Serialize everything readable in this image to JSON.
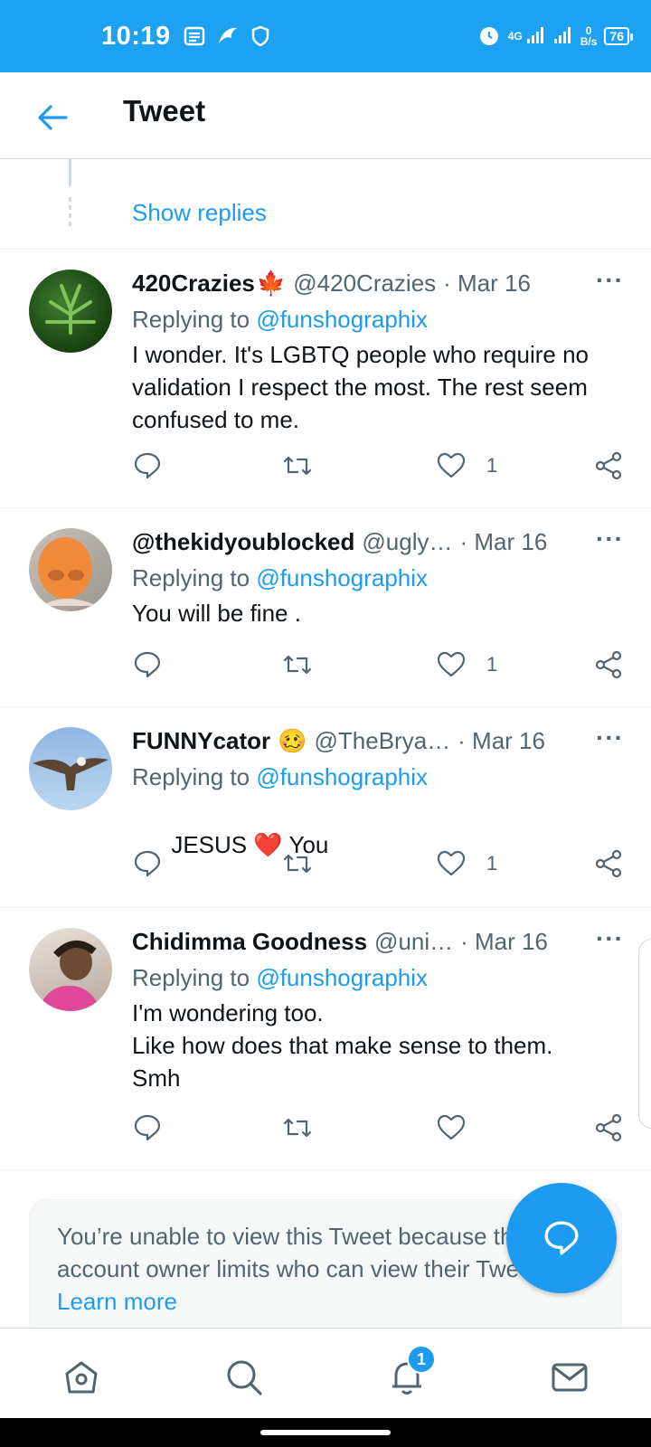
{
  "status_bar": {
    "time": "10:19",
    "network": "4G",
    "speed_top": "0",
    "speed_unit": "B/s",
    "battery": "76"
  },
  "header": {
    "title": "Tweet"
  },
  "thread": {
    "show_replies": "Show replies"
  },
  "tweets": [
    {
      "name": "420Crazies",
      "flag": "🍁",
      "handle": "@420Crazies",
      "date": "· Mar 16",
      "replying_prefix": "Replying to ",
      "replying_to": "@funshographix",
      "text": "I wonder. It's LGBTQ people who require no validation I respect the most. The rest seem confused to me.",
      "likes": "1"
    },
    {
      "name": "@thekidyoublocked",
      "handle": "@ugly…",
      "date": "· Mar 16",
      "replying_prefix": "Replying to ",
      "replying_to": "@funshographix",
      "text": "You will be fine .",
      "likes": "1"
    },
    {
      "name": "FUNNYcator",
      "emoji": "🥴",
      "handle": "@TheBrya…",
      "date": "· Mar 16",
      "replying_prefix": "Replying to ",
      "replying_to": "@funshographix",
      "text_a": "JESUS ",
      "heart": "❤️",
      "text_b": " You",
      "likes": "1"
    },
    {
      "name": "Chidimma Goodness",
      "handle": "@uni…",
      "date": "· Mar 16",
      "replying_prefix": "Replying to ",
      "replying_to": "@funshographix",
      "text": "I'm wondering too.\nLike how does that make sense to them.\nSmh",
      "likes": ""
    }
  ],
  "more_label": "···",
  "locked_notice": {
    "text": "You’re unable to view this Tweet because this account owner limits who can view their Tweets. ",
    "learn_more": "Learn more"
  },
  "bottom_nav": {
    "notification_count": "1"
  },
  "colors": {
    "brand": "#1d9bf0",
    "status_bar": "#1da1f2",
    "secondary_text": "#536471"
  }
}
